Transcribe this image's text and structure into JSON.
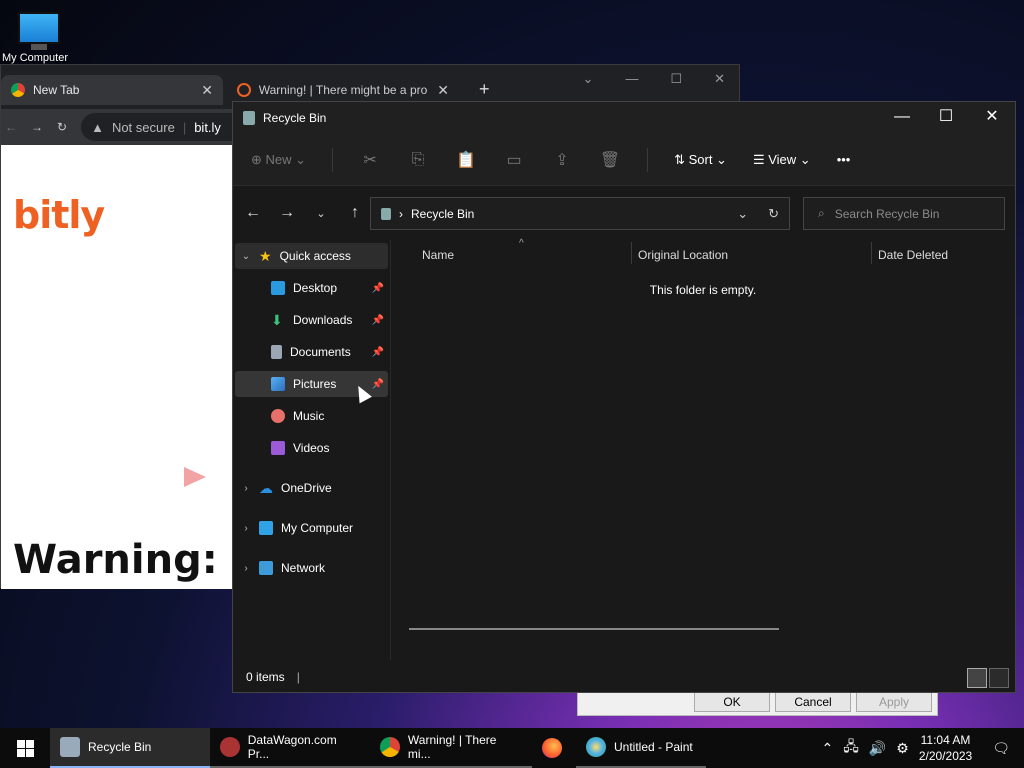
{
  "desktop": {
    "icon_label": "My Computer"
  },
  "chrome": {
    "tab1_title": "New Tab",
    "tab2_title": "Warning! | There might be a pro",
    "not_secure": "Not secure",
    "url": "bit.ly",
    "logo_text": "bitly",
    "warning_heading": "Warning:"
  },
  "dialog": {
    "ok": "OK",
    "cancel": "Cancel",
    "apply": "Apply"
  },
  "explorer": {
    "window_title": "Recycle Bin",
    "toolbar": {
      "new_label": "New",
      "sort_label": "Sort",
      "view_label": "View",
      "more": "•••"
    },
    "breadcrumb": "Recycle Bin",
    "search_placeholder": "Search Recycle Bin",
    "nav": {
      "quick_access": "Quick access",
      "desktop": "Desktop",
      "downloads": "Downloads",
      "documents": "Documents",
      "pictures": "Pictures",
      "music": "Music",
      "videos": "Videos",
      "onedrive": "OneDrive",
      "mycomputer": "My Computer",
      "network": "Network"
    },
    "columns": {
      "name": "Name",
      "original_location": "Original Location",
      "date_deleted": "Date Deleted"
    },
    "empty_message": "This folder is empty.",
    "status": "0 items"
  },
  "taskbar": {
    "apps": [
      "Recycle Bin",
      "DataWagon.com Pr...",
      "Warning! | There mi...",
      "",
      "Untitled - Paint"
    ],
    "time": "11:04 AM",
    "date": "2/20/2023"
  },
  "colors": {
    "accent": "#8ab4f8",
    "bitly_orange": "#ee6123",
    "folder_yellow": "#f5c518"
  }
}
